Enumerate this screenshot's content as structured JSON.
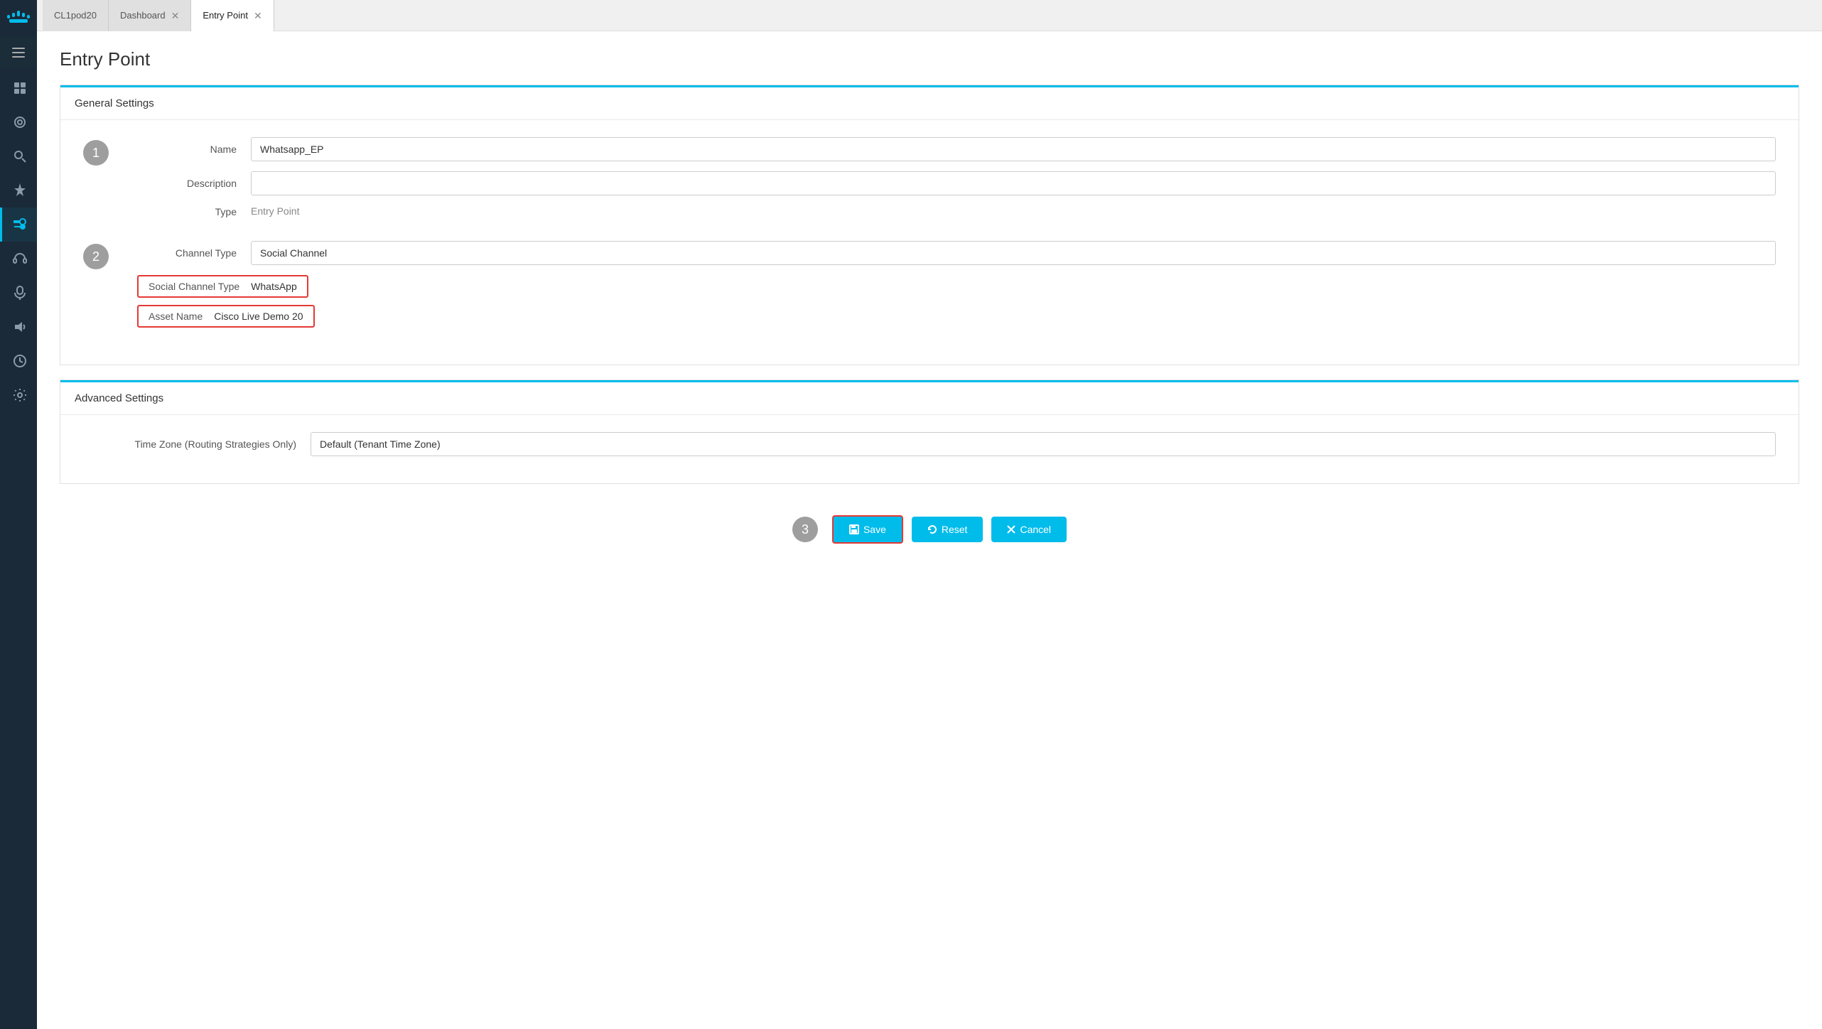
{
  "sidebar": {
    "logo_alt": "Cisco",
    "items": [
      {
        "id": "home",
        "icon": "⊞",
        "label": "Home"
      },
      {
        "id": "routing",
        "icon": "◎",
        "label": "Routing"
      },
      {
        "id": "search",
        "icon": "🔍",
        "label": "Search"
      },
      {
        "id": "pin",
        "icon": "📌",
        "label": "Pinned"
      },
      {
        "id": "tools",
        "icon": "🔧",
        "label": "Tools"
      },
      {
        "id": "headset",
        "icon": "🎧",
        "label": "Headset"
      },
      {
        "id": "mic",
        "icon": "🎤",
        "label": "Microphone"
      },
      {
        "id": "volume",
        "icon": "🔊",
        "label": "Volume"
      },
      {
        "id": "history",
        "icon": "⟳",
        "label": "History"
      },
      {
        "id": "settings",
        "icon": "⚙",
        "label": "Settings"
      }
    ]
  },
  "tabs": [
    {
      "id": "cl1pod20",
      "label": "CL1pod20",
      "closable": false,
      "active": false
    },
    {
      "id": "dashboard",
      "label": "Dashboard",
      "closable": true,
      "active": false
    },
    {
      "id": "entry-point",
      "label": "Entry Point",
      "closable": true,
      "active": true
    }
  ],
  "page": {
    "title": "Entry Point"
  },
  "general_settings": {
    "section_label": "General Settings",
    "step1": "1",
    "name_label": "Name",
    "name_value": "Whatsapp_EP",
    "description_label": "Description",
    "description_value": "",
    "type_label": "Type",
    "type_value": "Entry Point",
    "channel_type_label": "Channel Type",
    "channel_type_value": "Social Channel",
    "step2": "2",
    "social_channel_type_label": "Social Channel Type",
    "social_channel_type_value": "WhatsApp",
    "asset_name_label": "Asset Name",
    "asset_name_value": "Cisco Live Demo 20"
  },
  "advanced_settings": {
    "section_label": "Advanced Settings",
    "timezone_label": "Time Zone (Routing Strategies Only)",
    "timezone_value": "Default (Tenant Time Zone)"
  },
  "actions": {
    "step3": "3",
    "save_label": "Save",
    "reset_label": "Reset",
    "cancel_label": "Cancel"
  }
}
